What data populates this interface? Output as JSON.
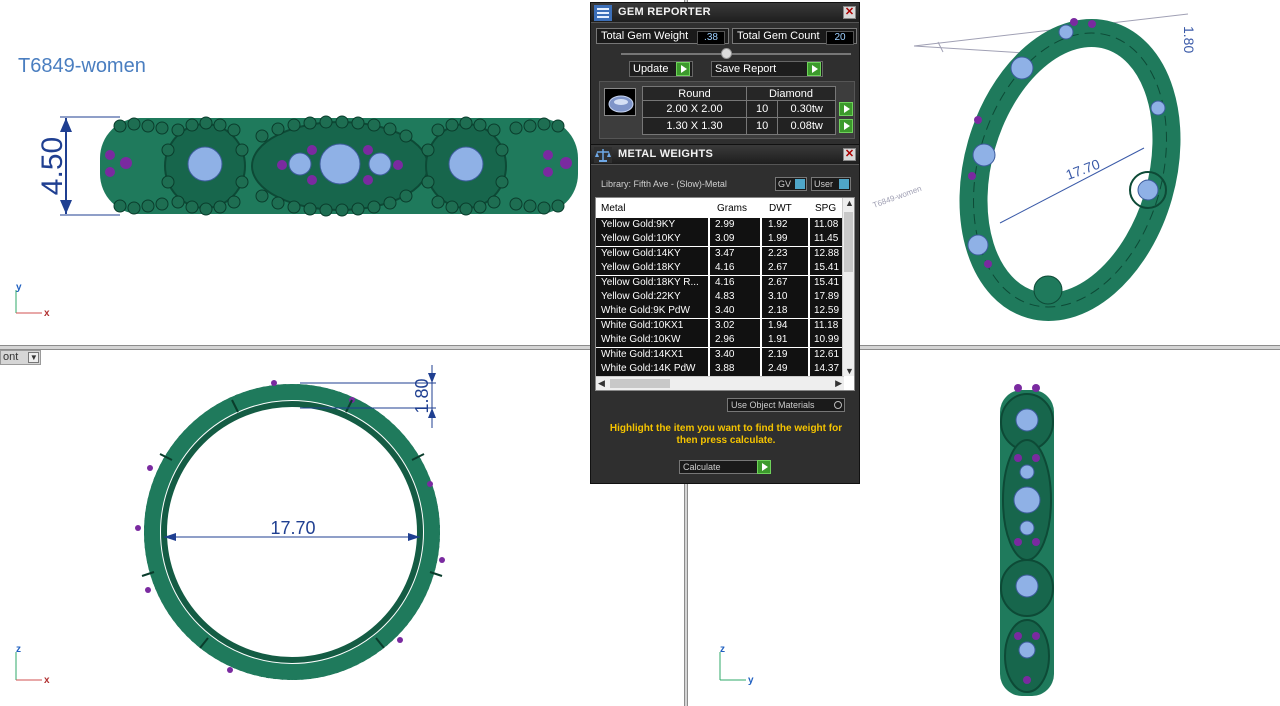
{
  "colors": {
    "metal": "#1f7a5c",
    "bead": "#1e6e52",
    "gem": "#8fb1e6",
    "accent_stone": "#7a2aa0",
    "dimension": "#1f3f91",
    "label_blue": "#4a7ec0",
    "panel_bg": "#2f2f2f",
    "hint_yellow": "#f5c400"
  },
  "viewports": {
    "top_left": {
      "label": "T6849-women",
      "dimension": "4.50",
      "axes": {
        "vertical": "y",
        "horizontal": "x"
      }
    },
    "top_right": {
      "dimension_ring": "17.70",
      "dimension_band": "1.80",
      "ghost_label": "T6849-women"
    },
    "bottom_left": {
      "menu_label": "ont",
      "dimension_ring": "17.70",
      "dimension_band": "1.80",
      "axes": {
        "vertical": "z",
        "horizontal": "x"
      }
    },
    "bottom_right": {
      "axes": {
        "vertical": "z",
        "horizontal": "y"
      }
    }
  },
  "gem_reporter": {
    "title": "GEM REPORTER",
    "total_weight_label": "Total Gem Weight",
    "total_weight_value": ".38",
    "total_count_label": "Total Gem Count",
    "total_count_value": "20",
    "update_label": "Update",
    "save_report_label": "Save Report",
    "table": {
      "shape": "Round",
      "material": "Diamond",
      "rows": [
        {
          "size": "2.00 X 2.00",
          "count": "10",
          "weight": "0.30tw"
        },
        {
          "size": "1.30 X 1.30",
          "count": "10",
          "weight": "0.08tw"
        }
      ]
    }
  },
  "metal_weights": {
    "title": "METAL WEIGHTS",
    "library": "Library: Fifth Ave - (Slow)-Metal",
    "toggle_gv": "GV",
    "toggle_user": "User",
    "columns": [
      "Metal",
      "Grams",
      "DWT",
      "SPG"
    ],
    "rows": [
      [
        "Yellow Gold:9KY",
        "2.99",
        "1.92",
        "11.08"
      ],
      [
        "Yellow Gold:10KY",
        "3.09",
        "1.99",
        "11.45"
      ],
      [
        "Yellow Gold:14KY",
        "3.47",
        "2.23",
        "12.88"
      ],
      [
        "Yellow Gold:18KY",
        "4.16",
        "2.67",
        "15.41"
      ],
      [
        "Yellow Gold:18KY R...",
        "4.16",
        "2.67",
        "15.41"
      ],
      [
        "Yellow Gold:22KY",
        "4.83",
        "3.10",
        "17.89"
      ],
      [
        "White Gold:9K PdW",
        "3.40",
        "2.18",
        "12.59"
      ],
      [
        "White Gold:10KX1",
        "3.02",
        "1.94",
        "11.18"
      ],
      [
        "White Gold:10KW",
        "2.96",
        "1.91",
        "10.99"
      ],
      [
        "White Gold:14KX1",
        "3.40",
        "2.19",
        "12.61"
      ],
      [
        "White Gold:14K PdW",
        "3.88",
        "2.49",
        "14.37"
      ]
    ],
    "use_object_materials": "Use Object Materials",
    "hint": "Highlight the item you want to find the weight for then press calculate.",
    "calculate_label": "Calculate"
  }
}
